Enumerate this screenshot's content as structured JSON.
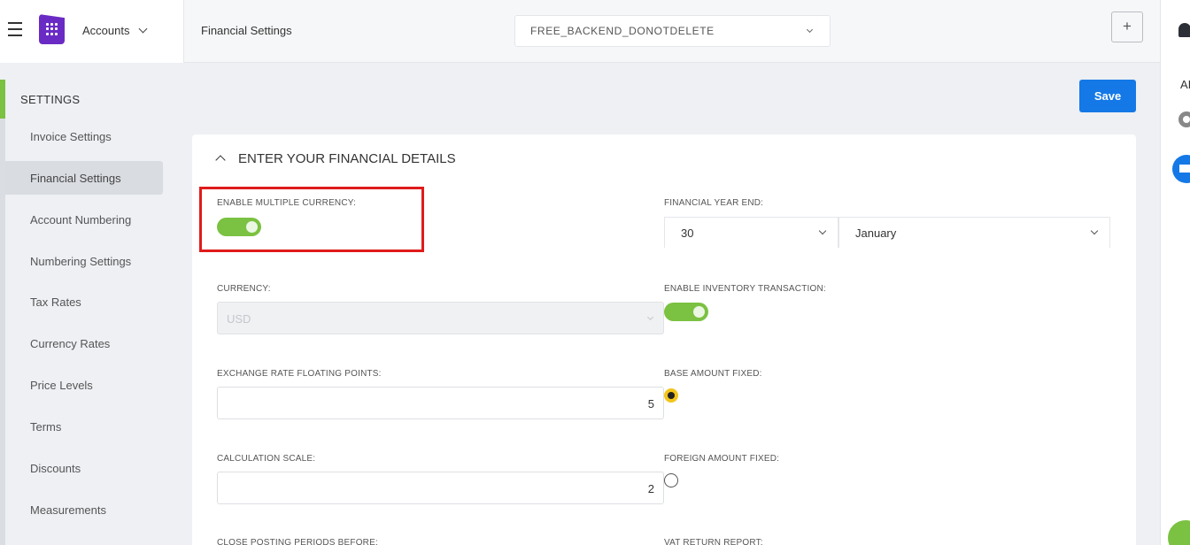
{
  "topbar": {
    "app_menu_label": "Accounts",
    "page_title": "Financial Settings",
    "company_selector": "FREE_BACKEND_DONOTDELETE",
    "add_button": "+"
  },
  "right_rail": {
    "ai_label": "AI"
  },
  "sidebar": {
    "heading": "SETTINGS",
    "items": [
      {
        "label": "Invoice Settings"
      },
      {
        "label": "Financial Settings"
      },
      {
        "label": "Account Numbering"
      },
      {
        "label": "Numbering Settings"
      },
      {
        "label": "Tax Rates"
      },
      {
        "label": "Currency Rates"
      },
      {
        "label": "Price Levels"
      },
      {
        "label": "Terms"
      },
      {
        "label": "Discounts"
      },
      {
        "label": "Measurements"
      }
    ],
    "active_index": 1
  },
  "actions": {
    "save_label": "Save"
  },
  "card": {
    "title": "ENTER YOUR FINANCIAL DETAILS",
    "enable_multiple_currency": {
      "label": "ENABLE MULTIPLE CURRENCY:",
      "on": true
    },
    "financial_year_end": {
      "label": "FINANCIAL YEAR END:",
      "day": "30",
      "month": "January"
    },
    "currency": {
      "label": "CURRENCY:",
      "value": "USD",
      "disabled": true
    },
    "enable_inventory_transaction": {
      "label": "ENABLE INVENTORY TRANSACTION:",
      "on": true
    },
    "exchange_rate_floating_points": {
      "label": "EXCHANGE RATE FLOATING POINTS:",
      "value": "5"
    },
    "base_amount_fixed": {
      "label": "BASE AMOUNT FIXED:",
      "selected": true
    },
    "calculation_scale": {
      "label": "CALCULATION SCALE:",
      "value": "2"
    },
    "foreign_amount_fixed": {
      "label": "FOREIGN AMOUNT FIXED:",
      "selected": false
    },
    "close_posting_periods_before": {
      "label": "CLOSE POSTING PERIODS BEFORE:"
    },
    "vat_return_report": {
      "label": "VAT RETURN REPORT:"
    }
  },
  "colors": {
    "accent_green": "#7bc142",
    "primary_blue": "#1479e6",
    "highlight_red": "#e01b1b",
    "radio_yellow": "#f3c51c",
    "brand_purple": "#6a2bc4"
  }
}
